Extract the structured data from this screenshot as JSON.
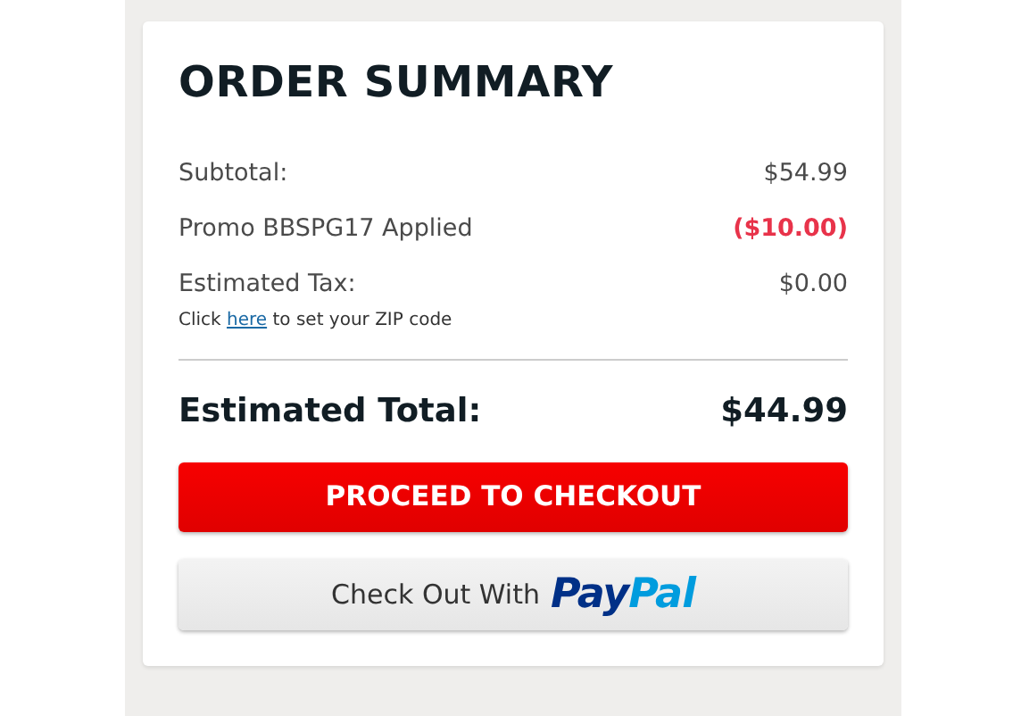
{
  "title": "ORDER SUMMARY",
  "lines": [
    {
      "label": "Subtotal:",
      "value": "$54.99",
      "kind": "amount"
    },
    {
      "label": "Promo BBSPG17 Applied",
      "value": "($10.00)",
      "kind": "discount"
    },
    {
      "label": "Estimated Tax:",
      "value": "$0.00",
      "kind": "amount"
    }
  ],
  "zip_note": {
    "before": "Click",
    "link": "here",
    "after": "to set your ZIP code"
  },
  "total": {
    "label": "Estimated Total:",
    "value": "$44.99"
  },
  "checkout_button": "PROCEED TO CHECKOUT",
  "paypal_button": {
    "label": "Check Out With",
    "logo": [
      "Pay",
      "Pal"
    ]
  }
}
